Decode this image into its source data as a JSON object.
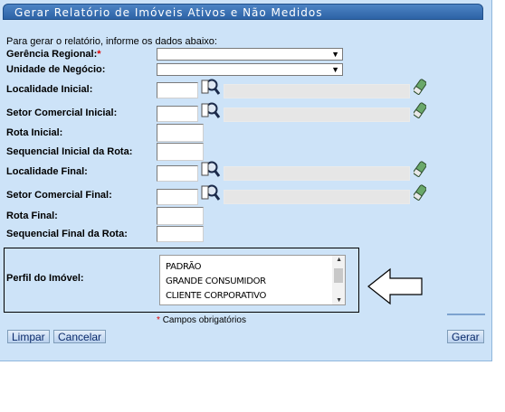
{
  "window": {
    "title": "Gerar Relatório de Imóveis Ativos e Não Medidos"
  },
  "form": {
    "intro": "Para gerar o relatório, informe os dados abaixo:",
    "gerencia_label": "Gerência Regional:",
    "gerencia_required": "*",
    "unidade_label": "Unidade de Negócio:",
    "localidade_inicial_label": "Localidade Inicial:",
    "setor_inicial_label": "Setor Comercial Inicial:",
    "rota_inicial_label": "Rota Inicial:",
    "seq_inicial_label": "Sequencial Inicial da Rota:",
    "localidade_final_label": "Localidade Final:",
    "setor_final_label": "Setor Comercial Final:",
    "rota_final_label": "Rota Final:",
    "seq_final_label": "Sequencial Final da Rota:",
    "perfil_label": "Perfil do Imóvel:",
    "perfil_options": [
      "PADRÃO",
      "GRANDE CONSUMIDOR",
      "CLIENTE CORPORATIVO"
    ],
    "required_mark": "*",
    "required_note": "Campos obrigatórios"
  },
  "buttons": {
    "limpar": "Limpar",
    "cancelar": "Cancelar",
    "gerar": "Gerar"
  },
  "icons": {
    "search": "magnifier-icon",
    "clear": "eraser-icon",
    "annotation": "left-arrow-icon"
  },
  "colors": {
    "panel": "#cde3f8",
    "title_bar": "#2d63a6",
    "required": "#e00000"
  }
}
